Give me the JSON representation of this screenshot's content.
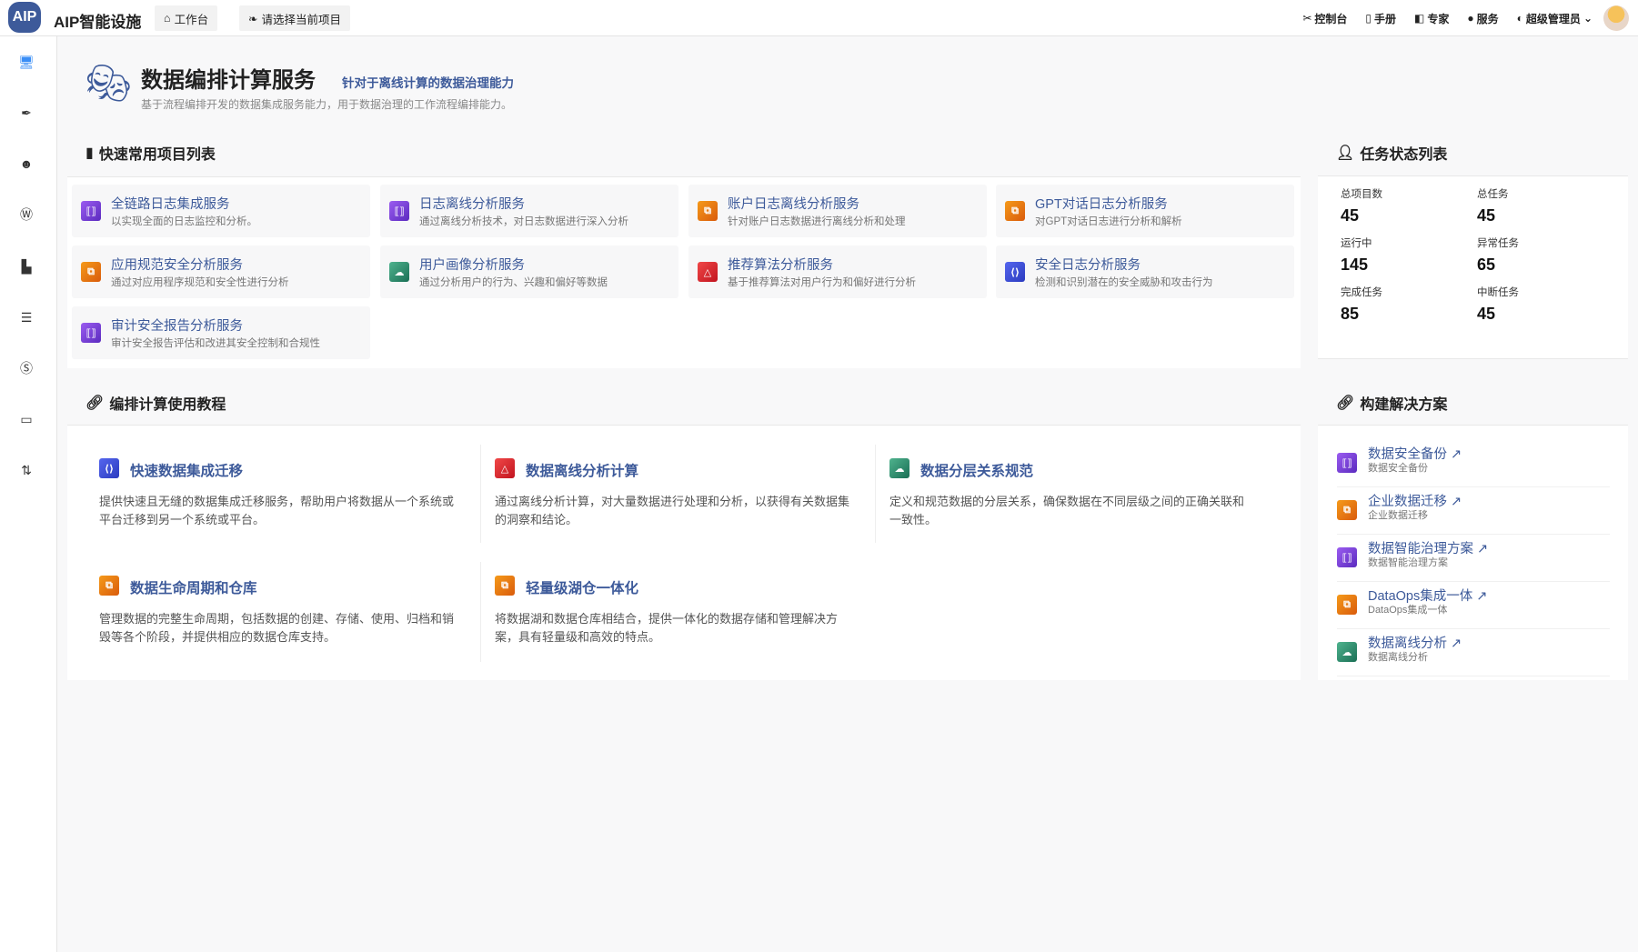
{
  "header": {
    "logo": "AIP",
    "brand": "AIP智能设施",
    "workbench": "工作台",
    "project_select": "请选择当前项目",
    "nav": [
      "控制台",
      "手册",
      "专家",
      "服务"
    ],
    "user": "超级管理员"
  },
  "page": {
    "title": "数据编排计算服务",
    "subtitle": "针对于离线计算的数据治理能力",
    "description": "基于流程编排开发的数据集成服务能力，用于数据治理的工作流程编排能力。"
  },
  "quick": {
    "title": "快速常用项目列表",
    "items": [
      {
        "title": "全链路日志集成服务",
        "desc": "以实现全面的日志监控和分析。",
        "color": "purple"
      },
      {
        "title": "日志离线分析服务",
        "desc": "通过离线分析技术，对日志数据进行深入分析",
        "color": "purple"
      },
      {
        "title": "账户日志离线分析服务",
        "desc": "针对账户日志数据进行离线分析和处理",
        "color": "orange"
      },
      {
        "title": "GPT对话日志分析服务",
        "desc": "对GPT对话日志进行分析和解析",
        "color": "orange"
      },
      {
        "title": "应用规范安全分析服务",
        "desc": "通过对应用程序规范和安全性进行分析",
        "color": "orange"
      },
      {
        "title": "用户画像分析服务",
        "desc": "通过分析用户的行为、兴趣和偏好等数据",
        "color": "green"
      },
      {
        "title": "推荐算法分析服务",
        "desc": "基于推荐算法对用户行为和偏好进行分析",
        "color": "red"
      },
      {
        "title": "安全日志分析服务",
        "desc": "检测和识别潜在的安全威胁和攻击行为",
        "color": "blue"
      },
      {
        "title": "审计安全报告分析服务",
        "desc": "审计安全报告评估和改进其安全控制和合规性",
        "color": "purple"
      }
    ]
  },
  "status": {
    "title": "任务状态列表",
    "items": [
      {
        "label": "总项目数",
        "value": "45"
      },
      {
        "label": "总任务",
        "value": "45"
      },
      {
        "label": "运行中",
        "value": "145"
      },
      {
        "label": "异常任务",
        "value": "65"
      },
      {
        "label": "完成任务",
        "value": "85"
      },
      {
        "label": "中断任务",
        "value": "45"
      }
    ]
  },
  "tutorials": {
    "title": "编排计算使用教程",
    "items": [
      {
        "title": "快速数据集成迁移",
        "desc": "提供快速且无缝的数据集成迁移服务，帮助用户将数据从一个系统或平台迁移到另一个系统或平台。",
        "color": "blue"
      },
      {
        "title": "数据离线分析计算",
        "desc": "通过离线分析计算，对大量数据进行处理和分析，以获得有关数据集的洞察和结论。",
        "color": "red"
      },
      {
        "title": "数据分层关系规范",
        "desc": "定义和规范数据的分层关系，确保数据在不同层级之间的正确关联和一致性。",
        "color": "green"
      },
      {
        "title": "数据生命周期和仓库",
        "desc": "管理数据的完整生命周期，包括数据的创建、存储、使用、归档和销毁等各个阶段，并提供相应的数据仓库支持。",
        "color": "orange"
      },
      {
        "title": "轻量级湖仓一体化",
        "desc": "将数据湖和数据仓库相结合，提供一体化的数据存储和管理解决方案，具有轻量级和高效的特点。",
        "color": "orange"
      }
    ]
  },
  "solutions": {
    "title": "构建解决方案",
    "items": [
      {
        "title": "数据安全备份",
        "sub": "数据安全备份",
        "color": "purple"
      },
      {
        "title": "企业数据迁移",
        "sub": "企业数据迁移",
        "color": "orange"
      },
      {
        "title": "数据智能治理方案",
        "sub": "数据智能治理方案",
        "color": "purple"
      },
      {
        "title": "DataOps集成一体",
        "sub": "DataOps集成一体",
        "color": "orange"
      },
      {
        "title": "数据离线分析",
        "sub": "数据离线分析",
        "color": "green"
      }
    ]
  }
}
